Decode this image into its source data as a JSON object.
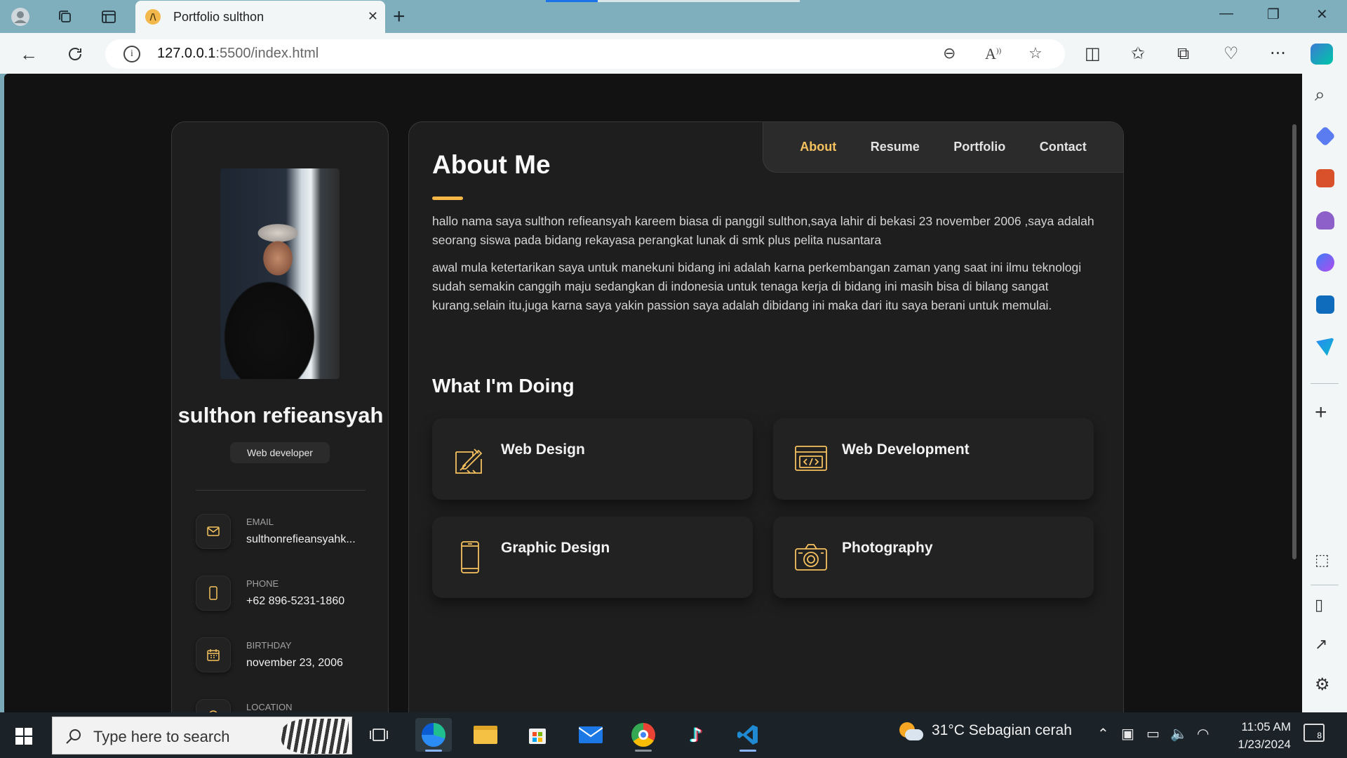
{
  "browser": {
    "tab_title": "Portfolio sulthon",
    "tab_favicon_letter": "/\\",
    "url_host": "127.0.0.1",
    "url_rest": ":5500/index.html"
  },
  "profile": {
    "name": "sulthon refieansyah",
    "role": "Web developer",
    "contacts": [
      {
        "label": "Email",
        "value": "sulthonrefieansyahk...",
        "icon": "mail-icon"
      },
      {
        "label": "Phone",
        "value": "+62 896-5231-1860",
        "icon": "phone-icon"
      },
      {
        "label": "Birthday",
        "value": "november 23, 2006",
        "icon": "calendar-icon"
      },
      {
        "label": "Location",
        "value": "",
        "icon": "location-icon"
      }
    ]
  },
  "navbar": {
    "items": [
      "About",
      "Resume",
      "Portfolio",
      "Contact"
    ],
    "active": "About"
  },
  "about": {
    "title": "About Me",
    "paragraphs": [
      "hallo nama saya sulthon refieansyah kareem biasa di panggil sulthon,saya lahir di bekasi 23 november 2006 ,saya adalah seorang siswa pada bidang rekayasa perangkat lunak di smk plus pelita nusantara",
      "awal mula ketertarikan saya untuk manekuni bidang ini adalah karna perkembangan zaman yang saat ini ilmu teknologi sudah semakin canggih maju sedangkan di indonesia untuk tenaga kerja di bidang ini masih bisa di bilang sangat kurang.selain itu,juga karna saya yakin passion saya adalah dibidang ini maka dari itu saya berani untuk memulai."
    ],
    "services_title": "What I'm Doing",
    "services": [
      {
        "title": "Web Design",
        "icon": "design-icon"
      },
      {
        "title": "Web Development",
        "icon": "code-icon"
      },
      {
        "title": "Graphic Design",
        "icon": "mobile-icon"
      },
      {
        "title": "Photography",
        "icon": "camera-icon"
      }
    ]
  },
  "taskbar": {
    "search_placeholder": "Type here to search",
    "weather": "31°C  Sebagian cerah",
    "time": "11:05 AM",
    "date": "1/23/2024",
    "notification_count": "8"
  },
  "colors": {
    "accent": "#f5c15e",
    "page_bg": "#121212",
    "card_bg": "#1e1e1f"
  }
}
